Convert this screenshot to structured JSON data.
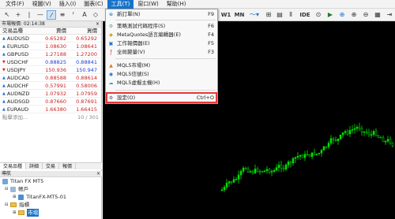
{
  "menubar": {
    "items": [
      {
        "label": "文件(F)"
      },
      {
        "label": "視圖(V)"
      },
      {
        "label": "插入(I)"
      },
      {
        "label": "圖表(C)"
      },
      {
        "label": "工具(T)"
      },
      {
        "label": "窗口(W)"
      },
      {
        "label": "幫助(H)"
      }
    ]
  },
  "toolbar": {
    "period_w1": "W1",
    "period_mn": "MN",
    "ide_label": "IDE"
  },
  "market_watch": {
    "title": "市場報價: 02:14:38",
    "close": "×",
    "headers": [
      "交易品種",
      "賣價",
      "買價"
    ],
    "rows": [
      {
        "symbol": "AUDUSD",
        "bid": "0.65282",
        "ask": "0.65292",
        "dir": "up",
        "bid_color": "red",
        "ask_color": "red"
      },
      {
        "symbol": "EURUSD",
        "bid": "1.08630",
        "ask": "1.08641",
        "dir": "up",
        "bid_color": "red",
        "ask_color": "red"
      },
      {
        "symbol": "GBPUSD",
        "bid": "1.27188",
        "ask": "1.27200",
        "dir": "up",
        "bid_color": "red",
        "ask_color": "red"
      },
      {
        "symbol": "USDCHF",
        "bid": "0.88825",
        "ask": "0.88841",
        "dir": "down",
        "bid_color": "blue",
        "ask_color": "blue"
      },
      {
        "symbol": "USDJPY",
        "bid": "150.936",
        "ask": "150.947",
        "dir": "down",
        "bid_color": "red",
        "ask_color": "blue"
      },
      {
        "symbol": "AUDCAD",
        "bid": "0.88588",
        "ask": "0.88614",
        "dir": "up",
        "bid_color": "red",
        "ask_color": "red"
      },
      {
        "symbol": "AUDCHF",
        "bid": "0.57991",
        "ask": "0.58006",
        "dir": "up",
        "bid_color": "red",
        "ask_color": "red"
      },
      {
        "symbol": "AUDNZD",
        "bid": "1.07932",
        "ask": "1.07959",
        "dir": "up",
        "bid_color": "red",
        "ask_color": "red"
      },
      {
        "symbol": "AUDSGD",
        "bid": "0.87660",
        "ask": "0.87691",
        "dir": "up",
        "bid_color": "red",
        "ask_color": "red"
      },
      {
        "symbol": "EURAUD",
        "bid": "1.66380",
        "ask": "1.66415",
        "dir": "up",
        "bid_color": "red",
        "ask_color": "red"
      }
    ],
    "add_label": "點擊添加...",
    "count": "10 / 301",
    "tabs": [
      "交易品種",
      "詳細",
      "交易",
      "報價"
    ]
  },
  "navigator": {
    "title": "導航",
    "close": "×",
    "items": [
      "Titan FX MT5",
      "帳戶",
      "TitanFX-MT5-01",
      "指標",
      "市場"
    ]
  },
  "tools_menu": {
    "items": [
      {
        "label": "新訂單(N)",
        "shortcut": "F9",
        "icon": "new-order-icon"
      },
      {
        "label": "策略測試代碼程序(S)",
        "shortcut": "F6",
        "icon": "tester-icon"
      },
      {
        "label": "MetaQuotes語言編輯器(E)",
        "shortcut": "F4",
        "icon": "editor-icon"
      },
      {
        "label": "工作報價器(E)",
        "shortcut": "F5",
        "icon": "terminal-icon"
      },
      {
        "label": "全局變量(V)",
        "shortcut": "F3",
        "icon": "variables-icon"
      },
      {
        "label": "MQL5市場(M)",
        "shortcut": "",
        "icon": "market-icon"
      },
      {
        "label": "MQL5信號(S)",
        "shortcut": "",
        "icon": "signals-icon"
      },
      {
        "label": "MQL5虛擬主機(H)",
        "shortcut": "",
        "icon": "vps-icon"
      },
      {
        "label": "設定(O)",
        "shortcut": "Ctrl+O",
        "icon": "settings-icon"
      }
    ]
  },
  "colors": {
    "accent": "#1874c9",
    "highlight": "#e53935",
    "candle": "#00e000",
    "chart_bg": "#000000"
  }
}
